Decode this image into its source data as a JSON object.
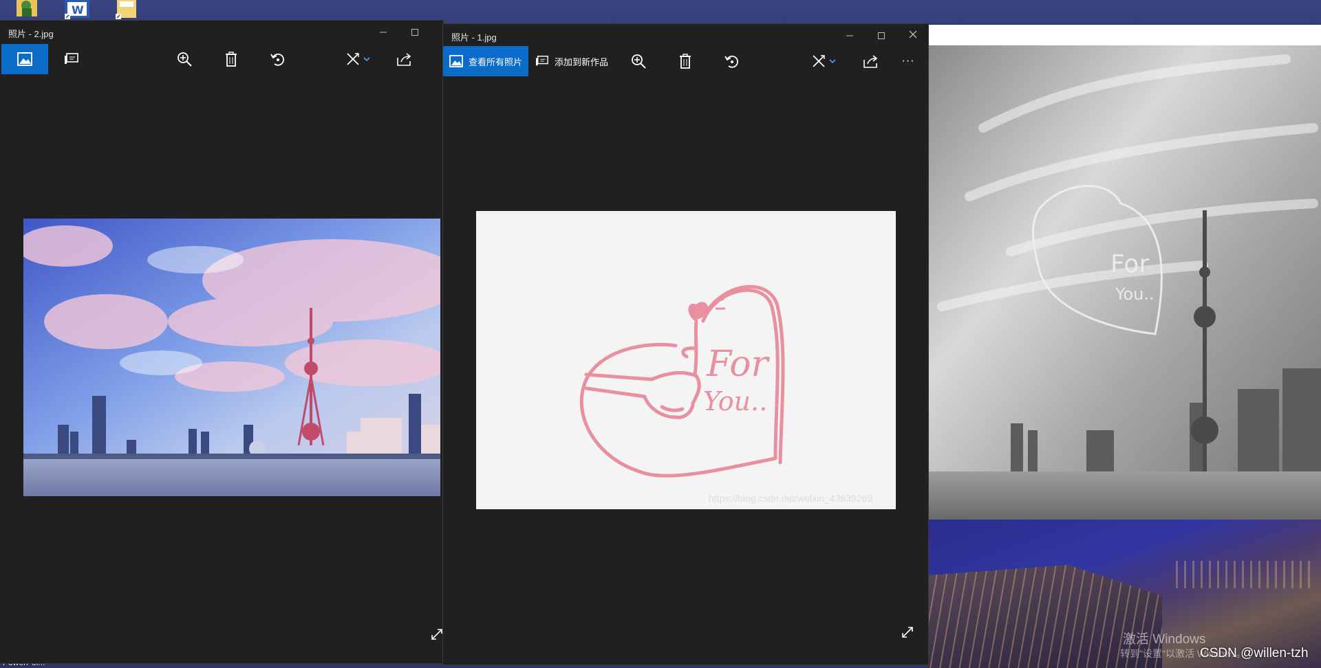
{
  "desktop": {
    "taskbar_label": "PowerPoi...",
    "activation_title": "激活 Windows",
    "activation_sub": "转到\"设置\"以激活 Windows。",
    "csdn_watermark": "CSDN @willen-tzh"
  },
  "window2": {
    "title": "照片 - 2.jpg",
    "toolbar": {
      "view_all_icon": "image-icon",
      "add_to_creation_icon": "slideshow-icon",
      "zoom_icon": "zoom-in-icon",
      "delete_icon": "trash-icon",
      "rotate_icon": "rotate-icon",
      "edit_icon": "edit-icon",
      "share_icon": "share-icon"
    }
  },
  "window1": {
    "title": "照片 - 1.jpg",
    "toolbar": {
      "view_all_label": "查看所有照片",
      "add_to_creation_label": "添加到新作品",
      "more_label": "···"
    },
    "image_text_line1": "For",
    "image_text_line2": "You..",
    "watermark": "https://blog.csdn.net/weixin_43639269"
  },
  "colors": {
    "accent": "#0a6cc8",
    "window_bg": "#202020",
    "heart_pink": "#e88fa0"
  }
}
